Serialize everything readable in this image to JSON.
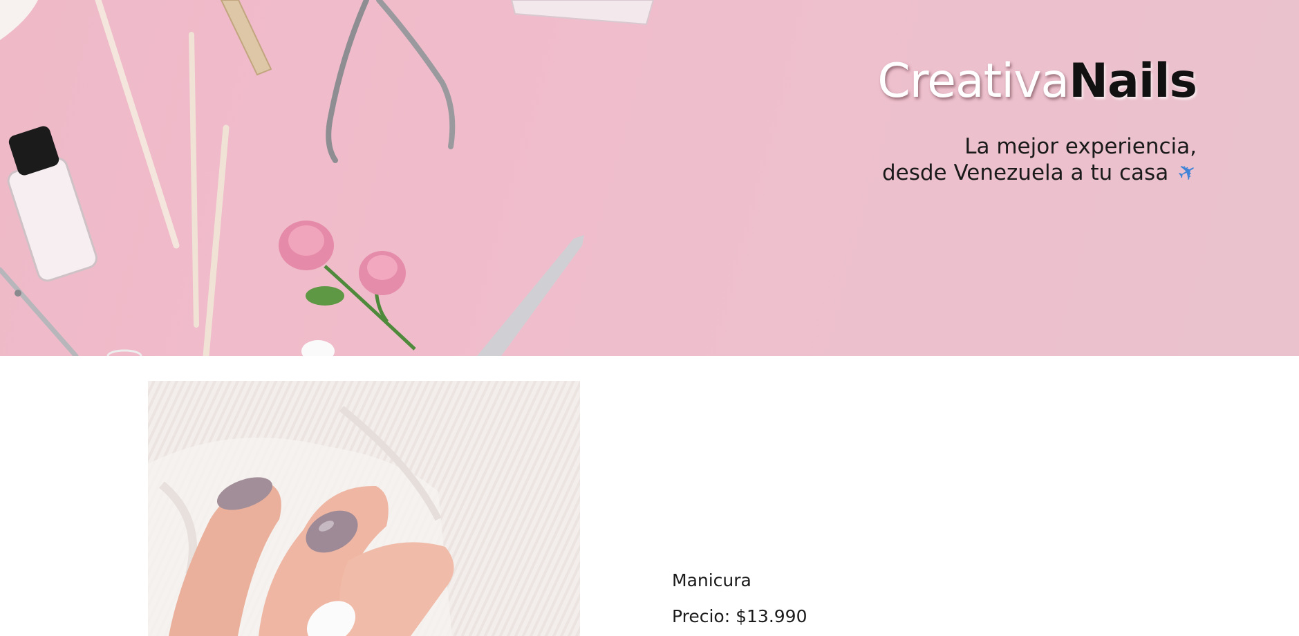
{
  "hero": {
    "brand_light": "Creativa",
    "brand_dark": "Nails",
    "tagline_line1": "La mejor experiencia,",
    "tagline_line2": "desde Venezuela a tu casa",
    "tagline_icon": "airplane-icon"
  },
  "product": {
    "image": "manicure-photo",
    "name": "Manicura",
    "price": "Precio: $13.990"
  },
  "colors": {
    "hero_background": "#efbccb",
    "text": "#1a1a1a",
    "page_background": "#ffffff"
  }
}
